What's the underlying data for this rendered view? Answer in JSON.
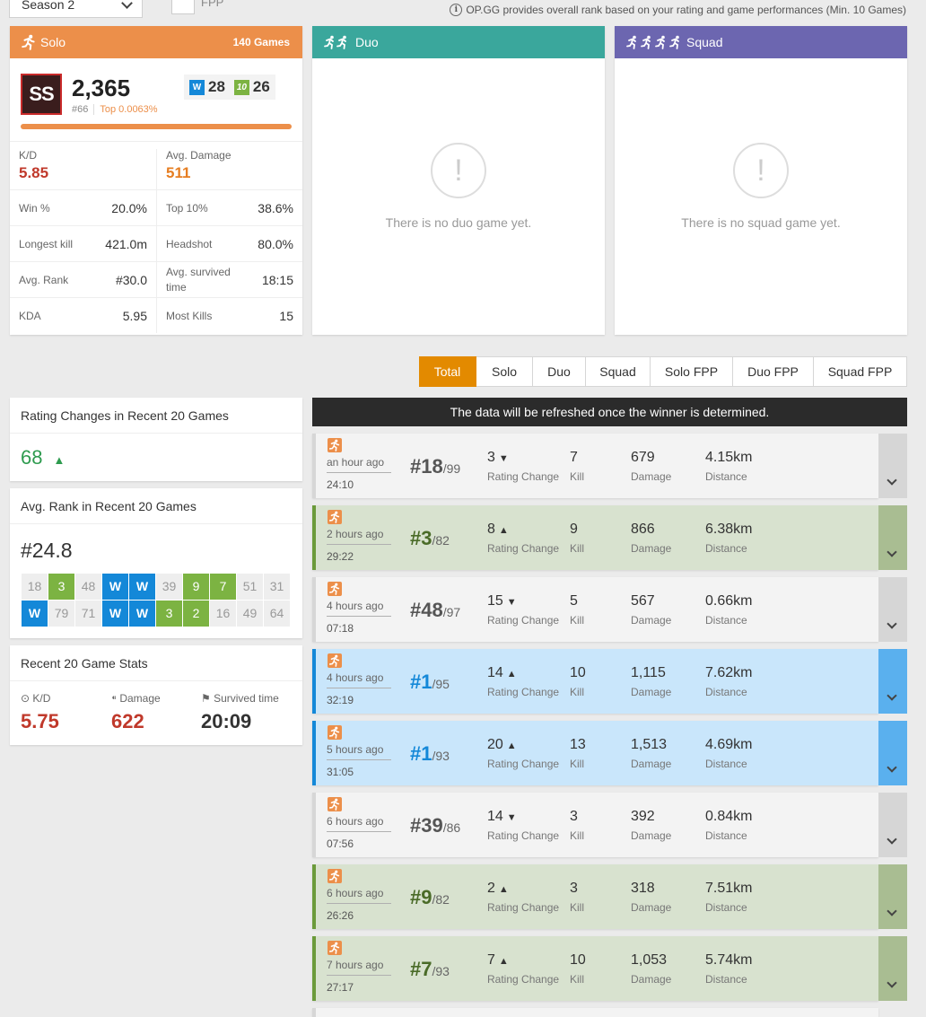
{
  "season": {
    "label": "Season 2"
  },
  "fpp": {
    "label": "FPP"
  },
  "notice": "OP.GG provides overall rank based on your rating and game performances (Min. 10 Games)",
  "solo": {
    "title": "Solo",
    "games": "140 Games",
    "tier": "SS",
    "rating": "2,365",
    "rank": "#66",
    "top": "Top 0.0063%",
    "wins": "28",
    "top10": "26",
    "win_icon": "W",
    "top10_icon": "10",
    "kd_label": "K/D",
    "kd": "5.85",
    "avg_dmg_label": "Avg. Damage",
    "avg_dmg": "511",
    "rows": [
      {
        "l1": "Win %",
        "v1": "20.0%",
        "l2": "Top 10%",
        "v2": "38.6%"
      },
      {
        "l1": "Longest kill",
        "v1": "421.0m",
        "l2": "Headshot",
        "v2": "80.0%"
      },
      {
        "l1": "Avg. Rank",
        "v1": "#30.0",
        "l2": "Avg. survived time",
        "v2": "18:15"
      },
      {
        "l1": "KDA",
        "v1": "5.95",
        "l2": "Most Kills",
        "v2": "15"
      }
    ]
  },
  "duo": {
    "title": "Duo",
    "empty": "There is no duo game yet.",
    "empty_icon": "!"
  },
  "squad": {
    "title": "Squad",
    "empty": "There is no squad game yet.",
    "empty_icon": "!"
  },
  "tabs": [
    {
      "label": "Total",
      "active": true
    },
    {
      "label": "Solo"
    },
    {
      "label": "Duo"
    },
    {
      "label": "Squad"
    },
    {
      "label": "Solo FPP"
    },
    {
      "label": "Duo FPP"
    },
    {
      "label": "Squad FPP"
    }
  ],
  "rating_changes": {
    "title": "Rating Changes in Recent 20 Games",
    "value": "68",
    "arrow": "▲"
  },
  "avg_rank": {
    "title": "Avg. Rank in Recent 20 Games",
    "value": "#24.8",
    "cells": [
      {
        "v": "18",
        "k": "n"
      },
      {
        "v": "3",
        "k": "g"
      },
      {
        "v": "48",
        "k": "n"
      },
      {
        "v": "W",
        "k": "w"
      },
      {
        "v": "W",
        "k": "w"
      },
      {
        "v": "39",
        "k": "n"
      },
      {
        "v": "9",
        "k": "g"
      },
      {
        "v": "7",
        "k": "g"
      },
      {
        "v": "51",
        "k": "n"
      },
      {
        "v": "31",
        "k": "n"
      },
      {
        "v": "W",
        "k": "w"
      },
      {
        "v": "79",
        "k": "n"
      },
      {
        "v": "71",
        "k": "n"
      },
      {
        "v": "W",
        "k": "w"
      },
      {
        "v": "W",
        "k": "w"
      },
      {
        "v": "3",
        "k": "g"
      },
      {
        "v": "2",
        "k": "g"
      },
      {
        "v": "16",
        "k": "n"
      },
      {
        "v": "49",
        "k": "n"
      },
      {
        "v": "64",
        "k": "n"
      }
    ]
  },
  "recent_stats": {
    "title": "Recent 20 Game Stats",
    "kd_label": "K/D",
    "kd": "5.75",
    "dmg_label": "Damage",
    "dmg": "622",
    "surv_label": "Survived time",
    "surv": "20:09"
  },
  "banner": "The data will be refreshed once the winner is determined.",
  "labels": {
    "rating_change": "Rating Change",
    "kill": "Kill",
    "damage": "Damage",
    "distance": "Distance"
  },
  "matches": [
    {
      "type": "lose",
      "ago": "an hour ago",
      "dur": "24:10",
      "rank": "#18",
      "total": "/99",
      "rc": "3",
      "dir": "down",
      "kill": "7",
      "dmg": "679",
      "dist": "4.15km"
    },
    {
      "type": "top10",
      "ago": "2 hours ago",
      "dur": "29:22",
      "rank": "#3",
      "total": "/82",
      "rc": "8",
      "dir": "up",
      "kill": "9",
      "dmg": "866",
      "dist": "6.38km"
    },
    {
      "type": "lose",
      "ago": "4 hours ago",
      "dur": "07:18",
      "rank": "#48",
      "total": "/97",
      "rc": "15",
      "dir": "down",
      "kill": "5",
      "dmg": "567",
      "dist": "0.66km"
    },
    {
      "type": "win",
      "ago": "4 hours ago",
      "dur": "32:19",
      "rank": "#1",
      "total": "/95",
      "rc": "14",
      "dir": "up",
      "kill": "10",
      "dmg": "1,115",
      "dist": "7.62km"
    },
    {
      "type": "win",
      "ago": "5 hours ago",
      "dur": "31:05",
      "rank": "#1",
      "total": "/93",
      "rc": "20",
      "dir": "up",
      "kill": "13",
      "dmg": "1,513",
      "dist": "4.69km"
    },
    {
      "type": "lose",
      "ago": "6 hours ago",
      "dur": "07:56",
      "rank": "#39",
      "total": "/86",
      "rc": "14",
      "dir": "down",
      "kill": "3",
      "dmg": "392",
      "dist": "0.84km"
    },
    {
      "type": "top10",
      "ago": "6 hours ago",
      "dur": "26:26",
      "rank": "#9",
      "total": "/82",
      "rc": "2",
      "dir": "up",
      "kill": "3",
      "dmg": "318",
      "dist": "7.51km"
    },
    {
      "type": "top10",
      "ago": "7 hours ago",
      "dur": "27:17",
      "rank": "#7",
      "total": "/93",
      "rc": "7",
      "dir": "up",
      "kill": "10",
      "dmg": "1,053",
      "dist": "5.74km"
    }
  ]
}
